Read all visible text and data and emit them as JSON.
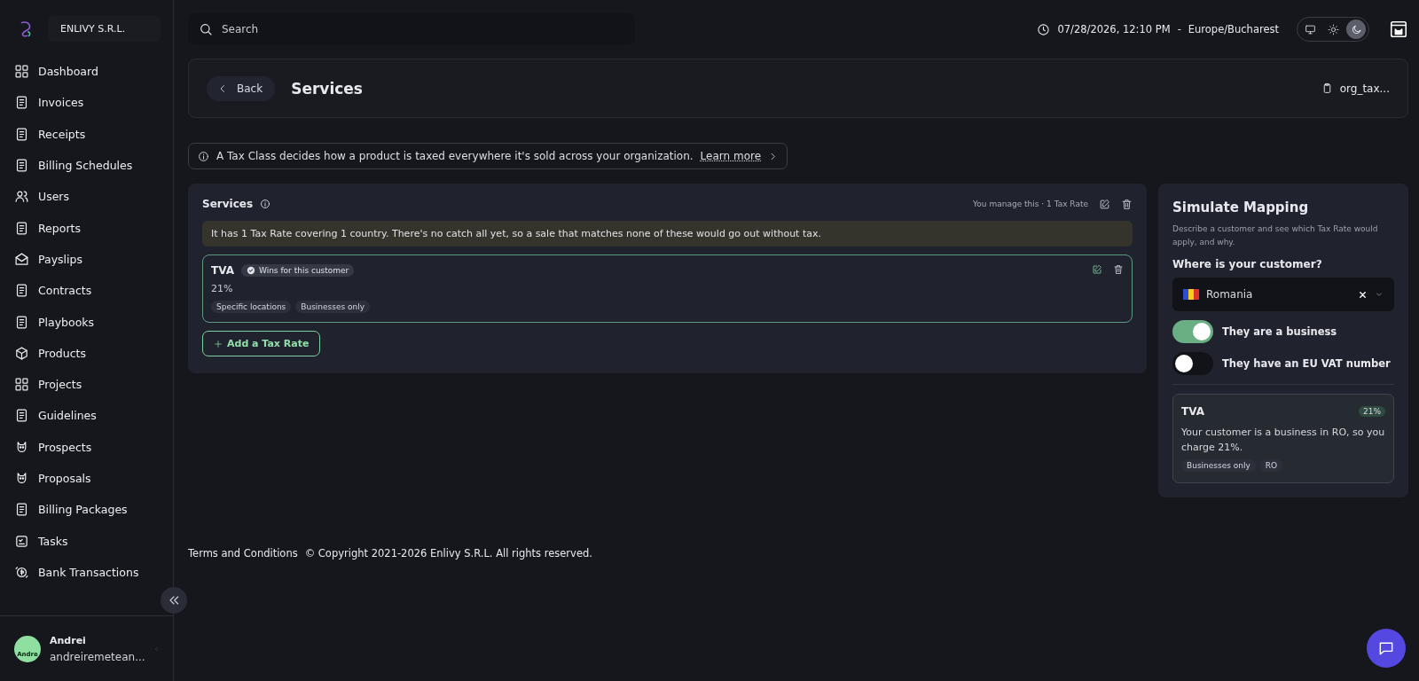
{
  "sidebar": {
    "org_name": "ENLIVY S.R.L.",
    "items": [
      {
        "label": "Dashboard",
        "selected": false
      },
      {
        "label": "Invoices",
        "selected": false
      },
      {
        "label": "Receipts",
        "selected": false
      },
      {
        "label": "Billing Schedules",
        "selected": false
      },
      {
        "label": "Users",
        "selected": false
      },
      {
        "label": "Reports",
        "selected": false
      },
      {
        "label": "Payslips",
        "selected": false
      },
      {
        "label": "Contracts",
        "selected": false
      },
      {
        "label": "Playbooks",
        "selected": false
      },
      {
        "label": "Products",
        "selected": false
      },
      {
        "label": "Projects",
        "selected": false
      },
      {
        "label": "Guidelines",
        "selected": false
      },
      {
        "label": "Prospects",
        "selected": false
      },
      {
        "label": "Proposals",
        "selected": false
      },
      {
        "label": "Billing Packages",
        "selected": false
      },
      {
        "label": "Tasks",
        "selected": false
      },
      {
        "label": "Bank Transactions",
        "selected": false
      }
    ],
    "user": {
      "avatar_text": "Andre",
      "name": "Andrei",
      "email": "andreiremetean..."
    }
  },
  "topbar": {
    "search": {
      "placeholder": "Search"
    },
    "datetime": "07/28/2026, 12:10 PM",
    "separator": "-",
    "timezone": "Europe/Bucharest",
    "theme_options": [
      {
        "kind": "system",
        "selected": false
      },
      {
        "kind": "light",
        "selected": false
      },
      {
        "kind": "dark",
        "selected": true
      }
    ]
  },
  "header": {
    "back_label": "Back",
    "title": "Services",
    "id_label": "org_tax..."
  },
  "info_bar": {
    "text": "A Tax Class decides how a product is taxed everywhere it's sold across your organization.",
    "link": "Learn more"
  },
  "tax_class": {
    "title": "Services",
    "meta": "You manage this · 1 Tax Rate",
    "notice": "It has 1 Tax Rate covering 1 country. There's no catch all yet, so a sale that matches none of these would go out without tax.",
    "rates": [
      {
        "name": "TVA",
        "badge": "Wins for this customer",
        "value": "21%",
        "tags": [
          "Specific locations",
          "Businesses only"
        ],
        "selected": true
      }
    ],
    "add_button": "Add a Tax Rate"
  },
  "simulate": {
    "title": "Simulate Mapping",
    "description": "Describe a customer and see which Tax Rate would apply, and why.",
    "question": "Where is your customer?",
    "country": "Romania",
    "toggles": [
      {
        "label": "They are a business",
        "on": true
      },
      {
        "label": "They have an EU VAT number",
        "on": false
      }
    ],
    "result": {
      "name": "TVA",
      "rate": "21%",
      "text": "Your customer is a business in RO, so you charge 21%.",
      "tags": [
        "Businesses only",
        "RO"
      ]
    }
  },
  "footer": {
    "link": "Terms and Conditions",
    "copyright": "© Copyright 2021-2026 Enlivy S.R.L. All rights reserved."
  }
}
